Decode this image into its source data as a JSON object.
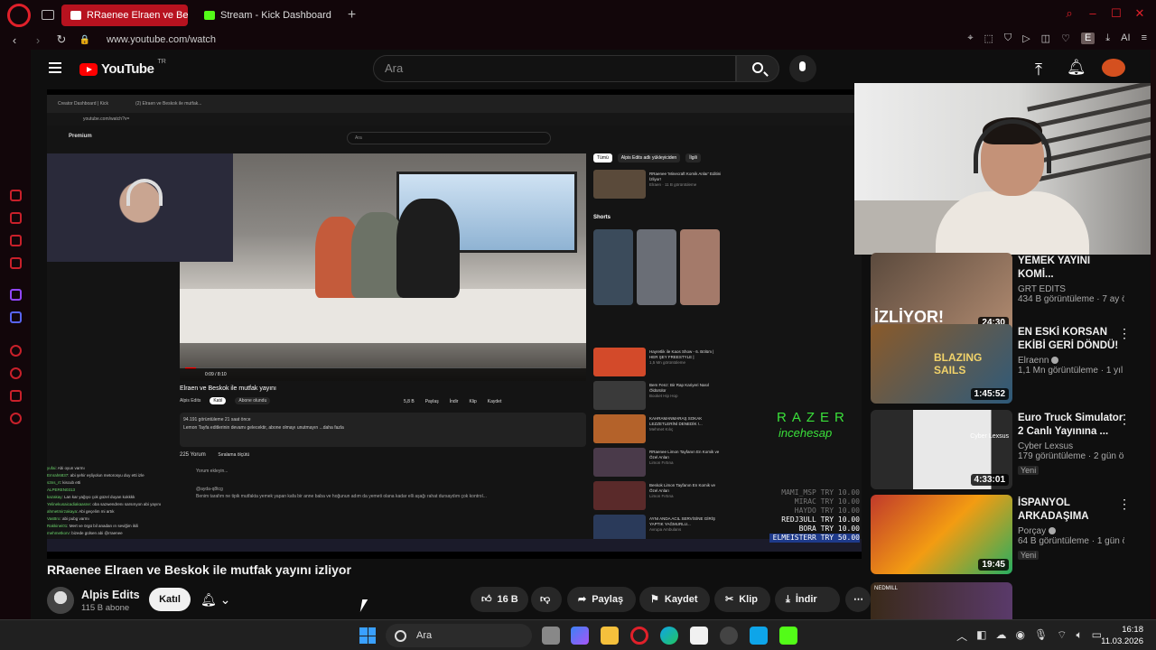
{
  "browser": {
    "tabs": [
      {
        "label": "RRaenee Elraen ve Be",
        "active": true
      },
      {
        "label": "Stream - Kick Dashboard",
        "active": false
      }
    ],
    "url": "www.youtube.com/watch",
    "ext_label": "E",
    "ai_label": "AI"
  },
  "youtube": {
    "logo_text": "YouTube",
    "country": "TR",
    "search_placeholder": "Ara"
  },
  "stream_overlay": {
    "inner_tab1": "Creator Dashboard | Kick",
    "inner_tab2": "(2) Elraen ve Beskok ile mutfak...",
    "inner_url": "youtube.com/watch?v=",
    "inner_premium": "Premium",
    "inner_search": "Ara",
    "inner_time": "0:09 / 8:10",
    "inner_title": "Elraen ve Beskok ile mutfak yayını",
    "inner_channel": "Alpis Edits",
    "inner_join": "Katıl",
    "inner_subscribed": "Abone olundu",
    "inner_actions": [
      "5,8 B",
      "Paylaş",
      "İndir",
      "Klip",
      "Kaydet"
    ],
    "inner_desc_1": "94.191 görüntüleme  21 saat önce",
    "inner_desc_2": "Lemon Tayfa editlerinin devamı gelecektir, abone olmayı unutmayın  ...daha fazla",
    "inner_comments": "225 Yorum",
    "inner_sort": "Sıralama ölçütü",
    "inner_add_comment": "Yorum ekleyin...",
    "inner_comment_user": "@ayda-q8tcg",
    "inner_comment_text": "Benim tarafım ne tipik mutfakta yemek yapan kafa bir anne baba ve hoğunun adım da yemeti olana kadar elli aşağı rahat dursaydım çok kontrol...",
    "inner_chips": [
      "Tümü",
      "Alpis Edits adlı yükleyiciden",
      "İlgili"
    ],
    "inner_shorts": "Shorts",
    "inner_side_items": [
      {
        "title": "RRaenee 'Minecraft Komik Anlar' Editini İzliyor!",
        "meta": "Elraen · 11 B görüntüleme"
      },
      {
        "title": "Hayretlik ile Kaos Show - 6. Bölüm | HER ŞEY FREESTYLE |",
        "meta": "1,5 Mn görüntüleme"
      },
      {
        "title": "Bem Fenz: Bir Rap Kariyeri Nasıl Öldürülür",
        "meta": "Booket Hip Hop"
      },
      {
        "title": "KAHRAMANMARAŞ SOKAK LEZZETLERİNİ DENEDİK !...",
        "meta": "Mehmet Kılıç"
      },
      {
        "title": "RRaenee Limon Tayfanın En Komik ve Özel Anları",
        "meta": "Limon Fırtına"
      },
      {
        "title": "Beskok Limon Tayfanın En Komik ve Özel Anları",
        "meta": "Limon Fırtına"
      },
      {
        "title": "AYNI ANDA ACIL SERVİSİNE GİRİŞ YAPTIK YAĞMURLU...",
        "meta": "Avrupa Ambulans"
      }
    ],
    "chat": [
      {
        "user": "yufai",
        "msg": "Abi oyun varmı"
      },
      {
        "user": "Emrah6837",
        "msg": "abi şehir eşliyolun metorosyu duy etti izle"
      },
      {
        "user": "s3ns_rt",
        "msg": "kiscub etti"
      },
      {
        "user": "ALPEREN0313",
        "msg": ""
      },
      {
        "user": "kazakay",
        "msg": "Lan kar yağıyo çok güzel duyan kokkkk"
      },
      {
        "user": "Yelinekusaicadiakaasne",
        "msg": "oba sazwendrenı sarsırıyon abi yayını"
      },
      {
        "user": "ahmetmirzakaya",
        "msg": "Abi geçelim mi artık"
      },
      {
        "user": "VasBro",
        "msg": "abi pubg varmı"
      },
      {
        "user": "Rakkinei01",
        "msg": "Mert ve örgü bil anadan ın seviğim ikili"
      },
      {
        "user": "mehmetkorv",
        "msg": "bizede gülsen abi @rraenee"
      }
    ],
    "razer_title": "RAZER",
    "razer_sub": "incehesap",
    "donations": [
      {
        "text": "MAMI_MSP TRY 10.00",
        "dim": true
      },
      {
        "text": "MIRAC TRY 10.00",
        "dim": true
      },
      {
        "text": "HAYDO TRY 10.00",
        "dim": true
      },
      {
        "text": "REDJ3ULL TRY 10.00",
        "dim": false
      },
      {
        "text": "BORA TRY 10.00",
        "dim": false
      },
      {
        "text": "ELMEISTERR TRY 50.00",
        "dim": false
      }
    ]
  },
  "video": {
    "title": "RRaenee Elraen ve Beskok ile mutfak yayını izliyor",
    "channel": "Alpis Edits",
    "subscribers": "115 B abone",
    "join_label": "Katıl",
    "like_count": "16 B",
    "share_label": "Paylaş",
    "save_label": "Kaydet",
    "clip_label": "Klip",
    "download_label": "İndir"
  },
  "recommendations": [
    {
      "title": "YEMEK YAYINI KOMİ...",
      "channel": "GRT EDITS",
      "views": "434 B görüntüleme · 7 ay önce",
      "duration": "24:30",
      "badge": "",
      "verified": false,
      "thumb_text": "İZLİYOR!"
    },
    {
      "title": "EN ESKİ KORSAN EKİBİ GERİ DÖNDÜ! |...",
      "channel": "Elraenn",
      "views": "1,1 Mn görüntüleme · 1 yıl ön...",
      "duration": "1:45:52",
      "badge": "",
      "verified": true,
      "thumb_text": "BLAZING SAILS"
    },
    {
      "title": "Euro Truck Simulator 2 Canlı Yayınına ...",
      "channel": "Cyber Lexsus",
      "views": "179 görüntüleme · 2 gün önce",
      "duration": "4:33:01",
      "badge": "Yeni",
      "verified": false,
      "thumb_text": "Cyber Lexsus"
    },
    {
      "title": "İSPANYOL ARKADAŞIMA TÜRK...",
      "channel": "Porçay",
      "views": "64 B görüntüleme · 1 gün ön...",
      "duration": "19:45",
      "badge": "Yeni",
      "verified": true,
      "thumb_text": ""
    },
    {
      "title": "",
      "channel": "",
      "views": "",
      "duration": "",
      "badge": "",
      "verified": false,
      "thumb_text": "NEDMILL"
    }
  ],
  "taskbar": {
    "search_placeholder": "Ara",
    "time": "16:18",
    "date": "11.03.2026"
  },
  "colors": {
    "opera_red": "#e0202a",
    "youtube_red": "#ff0000",
    "razer_green": "#3ae03a"
  }
}
